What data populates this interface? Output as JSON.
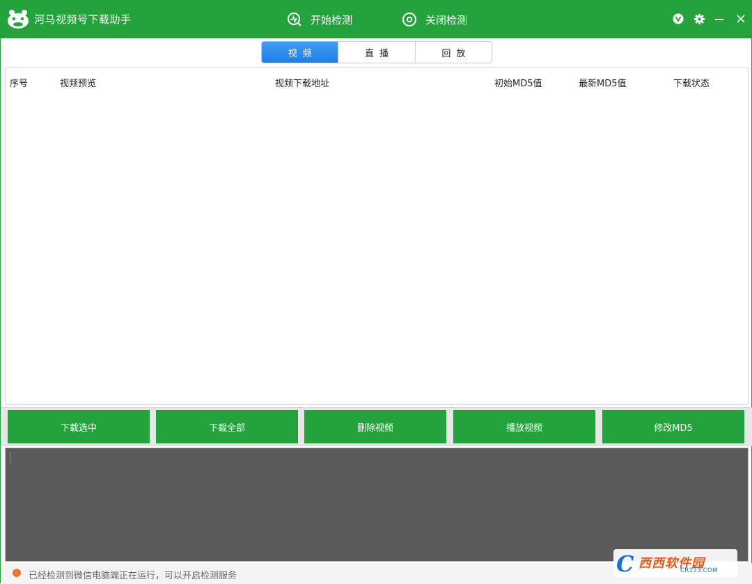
{
  "app": {
    "title": "河马视频号下载助手",
    "brand_color": "#24a33c"
  },
  "toolbar": {
    "start_label": "开始检测",
    "stop_label": "关闭检测"
  },
  "tabs": [
    {
      "label": "视频",
      "active": true
    },
    {
      "label": "直播",
      "active": false
    },
    {
      "label": "回放",
      "active": false
    }
  ],
  "table": {
    "columns": [
      "序号",
      "视频预览",
      "视频下载地址",
      "初始MD5值",
      "最新MD5值",
      "下载状态"
    ],
    "rows": []
  },
  "buttons": {
    "download_selected": "下载选中",
    "download_all": "下载全部",
    "delete_video": "删除视频",
    "play_video": "播放视频",
    "modify_md5": "修改MD5"
  },
  "status": {
    "text": "已经检测到微信电脑端正在运行，可以开启检测服务",
    "dot_color": "#e07a30"
  },
  "watermark": {
    "letter": "C",
    "text": "西西软件园",
    "url": "CR173.COM"
  }
}
